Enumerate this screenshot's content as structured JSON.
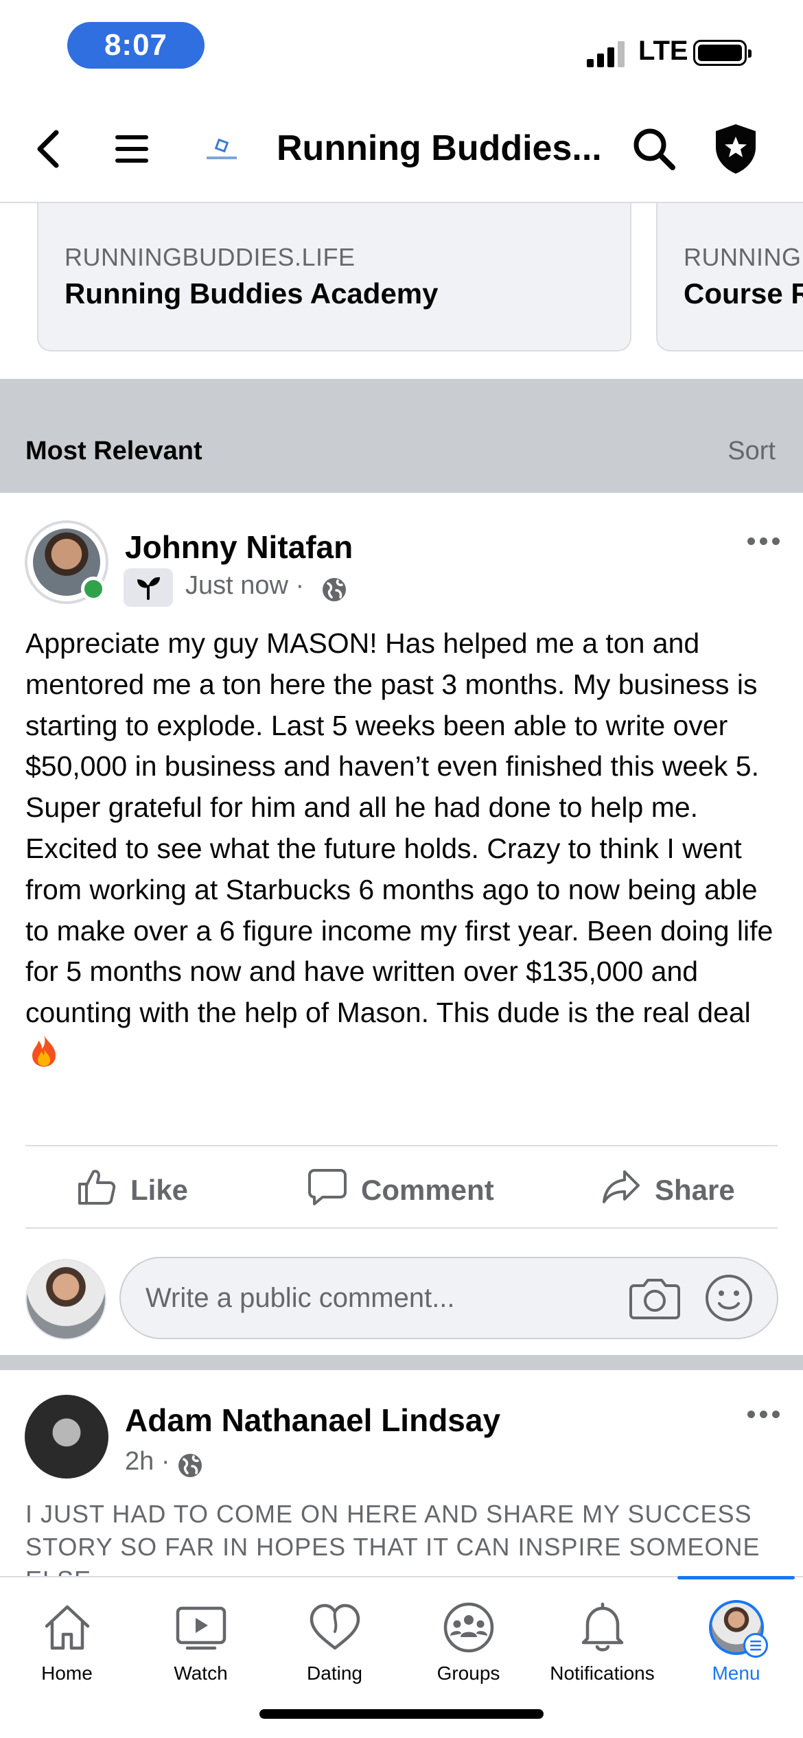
{
  "status": {
    "time": "8:07",
    "network": "LTE"
  },
  "nav": {
    "title": "Running Buddies..."
  },
  "links": [
    {
      "domain": "RUNNINGBUDDIES.LIFE",
      "title": "Running Buddies Academy"
    },
    {
      "domain": "RUNNINGB",
      "title": "Course R"
    }
  ],
  "sort": {
    "label": "Most Relevant",
    "button": "Sort"
  },
  "post": {
    "author": "Johnny Nitafan",
    "time": "Just now ·",
    "text": "Appreciate my guy MASON! Has helped me a ton and mentored me a ton here the past 3 months. My business is starting to explode. Last 5 weeks been able to write over $50,000 in business and haven’t even finished this week 5. Super grateful for him and all he had done to help me. Excited to see what the future holds. Crazy to think I went from working at Starbucks 6 months ago to now being able to make over a 6 figure income my first year. Been doing life for 5 months now and have written over $135,000 and counting with the help of Mason. This dude is the real deal",
    "actions": {
      "like": "Like",
      "comment": "Comment",
      "share": "Share"
    },
    "comment_placeholder": "Write a public comment..."
  },
  "post2": {
    "author": "Adam Nathanael Lindsay",
    "time": "2h ·",
    "text": "I JUST HAD TO COME ON HERE AND SHARE MY SUCCESS STORY SO FAR IN HOPES THAT IT CAN INSPIRE SOMEONE ELSE"
  },
  "tabs": [
    {
      "label": "Home",
      "icon": "home-icon"
    },
    {
      "label": "Watch",
      "icon": "watch-icon"
    },
    {
      "label": "Dating",
      "icon": "dating-icon"
    },
    {
      "label": "Groups",
      "icon": "groups-icon"
    },
    {
      "label": "Notifications",
      "icon": "bell-icon"
    },
    {
      "label": "Menu",
      "icon": "menu-avatar",
      "active": true
    }
  ],
  "colors": {
    "accent": "#1877f2",
    "time_pill": "#2f6fe0",
    "online": "#31a24c"
  }
}
